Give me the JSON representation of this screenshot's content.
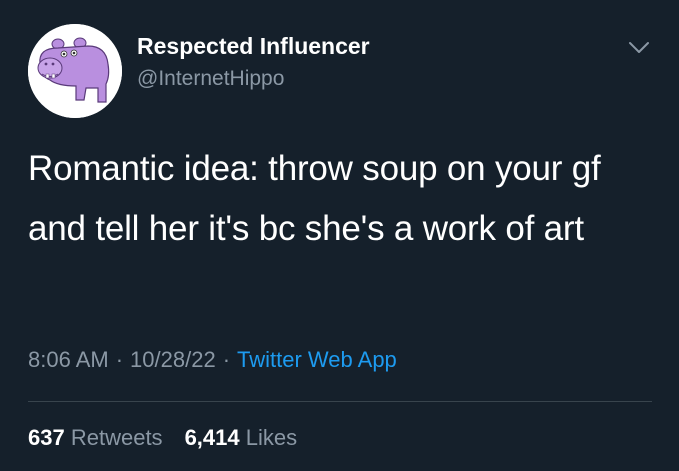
{
  "user": {
    "display_name": "Respected Influencer",
    "handle": "@InternetHippo",
    "avatar_icon": "hippo-avatar-icon"
  },
  "menu": {
    "icon": "chevron-down-icon"
  },
  "tweet": {
    "text": "Romantic idea: throw soup on your gf and tell her it's bc she's a work of art",
    "time": "8:06 AM",
    "separator": "·",
    "date": "10/28/22",
    "source": "Twitter Web App"
  },
  "stats": {
    "retweets_count": "637",
    "retweets_label": "Retweets",
    "likes_count": "6,414",
    "likes_label": "Likes"
  },
  "colors": {
    "background": "#15202b",
    "primary_text": "#ffffff",
    "secondary_text": "#8b98a5",
    "link": "#1d9bf0",
    "avatar_purple": "#b98fdf"
  }
}
